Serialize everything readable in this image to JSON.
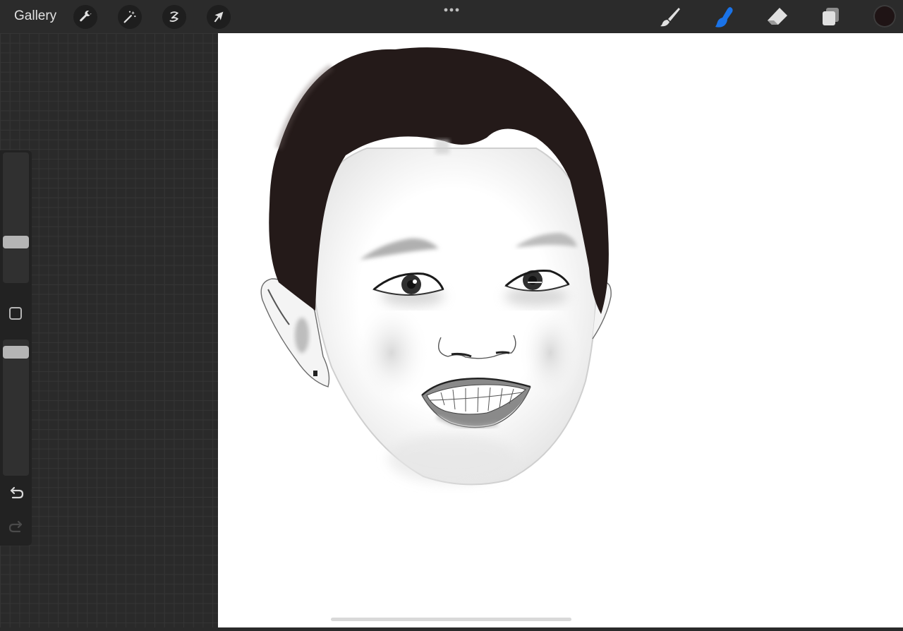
{
  "topbar": {
    "gallery_label": "Gallery",
    "left_tools": [
      "wrench-icon",
      "magic-wand-icon",
      "selection-icon",
      "transform-arrow-icon"
    ],
    "right_tools": [
      "brush-icon",
      "smudge-icon",
      "eraser-icon",
      "layers-icon"
    ],
    "active_tool": "smudge",
    "active_tool_color": "#1a73e8",
    "current_color": "#1f1415"
  },
  "sidebar": {
    "brush_size_level": 0.29,
    "opacity_level": 0.9
  },
  "theme": {
    "bar_bg": "#2b2b2b",
    "panel_bg": "#2a2a2a",
    "canvas_bg": "#ffffff",
    "hair_color": "#241a19"
  }
}
